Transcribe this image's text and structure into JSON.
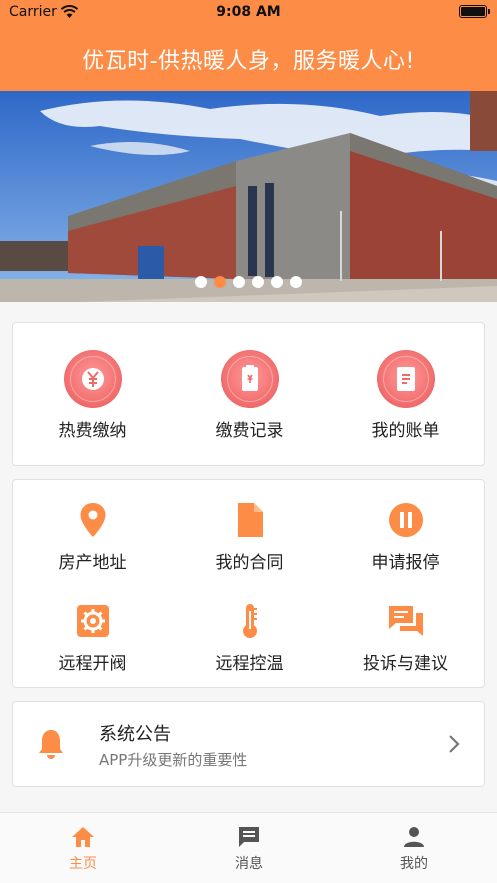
{
  "status_bar": {
    "carrier": "Carrier",
    "time": "9:08 AM"
  },
  "header": {
    "slogan": "优瓦时-供热暖人身，服务暖人心!"
  },
  "banner": {
    "total_slides": 6,
    "active_slide": 2
  },
  "services": [
    {
      "label": "热费缴纳",
      "icon": "yen-icon"
    },
    {
      "label": "缴费记录",
      "icon": "receipt-icon"
    },
    {
      "label": "我的账单",
      "icon": "bill-icon"
    }
  ],
  "features": [
    {
      "label": "房产地址",
      "icon": "location-pin-icon"
    },
    {
      "label": "我的合同",
      "icon": "document-icon"
    },
    {
      "label": "申请报停",
      "icon": "pause-icon"
    },
    {
      "label": "远程开阀",
      "icon": "gear-icon"
    },
    {
      "label": "远程控温",
      "icon": "thermometer-icon"
    },
    {
      "label": "投诉与建议",
      "icon": "chat-icon"
    }
  ],
  "notice": {
    "title": "系统公告",
    "subtitle": "APP升级更新的重要性"
  },
  "tabs": [
    {
      "label": "主页",
      "icon": "home-icon",
      "active": true
    },
    {
      "label": "消息",
      "icon": "message-icon",
      "active": false
    },
    {
      "label": "我的",
      "icon": "person-icon",
      "active": false
    }
  ],
  "colors": {
    "accent": "#fc8c46",
    "service_icon": "#f06a6a",
    "text": "#222222",
    "muted": "#777777",
    "tab_inactive": "#555555"
  }
}
